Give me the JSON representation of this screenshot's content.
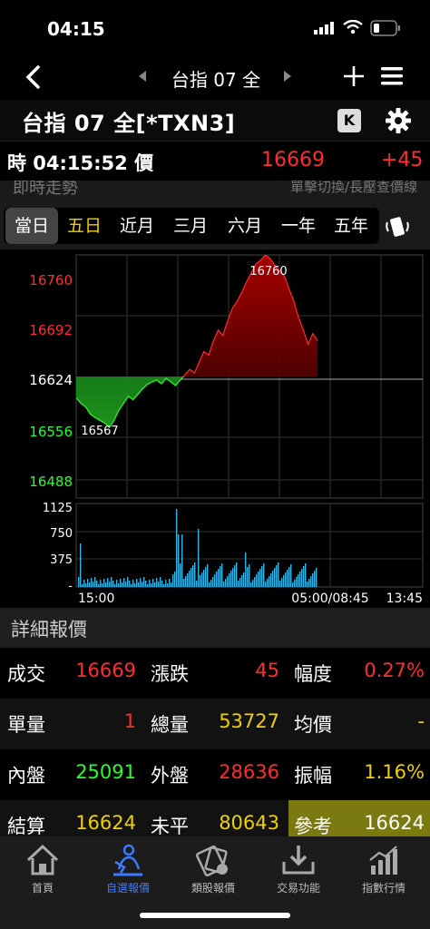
{
  "status": {
    "time": "04:15"
  },
  "nav": {
    "title": "台指 07 全"
  },
  "header": {
    "name": "台指 07 全[*TXN3]",
    "k_label": "K"
  },
  "quote": {
    "time_text": "時 04:15:52 價",
    "price": "16669",
    "change": "+45"
  },
  "subbar": {
    "left": "即時走勢",
    "right": "單擊切換/長壓查價線"
  },
  "periods": {
    "tabs": [
      {
        "label": "當日",
        "active": true
      },
      {
        "label": "五日",
        "highlight": true
      },
      {
        "label": "近月"
      },
      {
        "label": "三月"
      },
      {
        "label": "六月"
      },
      {
        "label": "一年"
      },
      {
        "label": "五年"
      }
    ]
  },
  "chart_data": {
    "type": "area",
    "reference": 16624,
    "ylim": [
      16488,
      16760
    ],
    "price_ticks": [
      "16760",
      "16692",
      "16624",
      "16556",
      "16488"
    ],
    "high_label": "16760",
    "low_label": "16567",
    "volume_ticks": [
      "1125",
      "750",
      "375",
      "-"
    ],
    "x_labels": [
      "15:00",
      "05:00/08:45",
      "13:45"
    ],
    "price_series": [
      16600,
      16594,
      16590,
      16582,
      16578,
      16575,
      16572,
      16567,
      16575,
      16586,
      16594,
      16602,
      16598,
      16604,
      16610,
      16615,
      16618,
      16620,
      16616,
      16622,
      16618,
      16614,
      16620,
      16626,
      16632,
      16628,
      16640,
      16652,
      16648,
      16664,
      16676,
      16670,
      16686,
      16700,
      16708,
      16718,
      16730,
      16740,
      16750,
      16754,
      16760,
      16756,
      16748,
      16742,
      16736,
      16722,
      16708,
      16690,
      16676,
      16660,
      16672,
      16664
    ],
    "up_color": "#ff2d2d",
    "down_color": "#28ff28"
  },
  "details": {
    "title": "詳細報價",
    "rows": [
      [
        {
          "label": "成交",
          "value": "16669",
          "color": "red"
        },
        {
          "label": "漲跌",
          "value": "45",
          "color": "red"
        },
        {
          "label": "幅度",
          "value": "0.27%",
          "color": "red"
        }
      ],
      [
        {
          "label": "單量",
          "value": "1",
          "color": "red"
        },
        {
          "label": "總量",
          "value": "53727",
          "color": "yellow"
        },
        {
          "label": "均價",
          "value": "-",
          "color": "yellow"
        }
      ],
      [
        {
          "label": "內盤",
          "value": "25091",
          "color": "green"
        },
        {
          "label": "外盤",
          "value": "28636",
          "color": "red"
        },
        {
          "label": "振幅",
          "value": "1.16%",
          "color": "yellow"
        }
      ],
      [
        {
          "label": "結算",
          "value": "16624",
          "color": "yellow"
        },
        {
          "label": "未平",
          "value": "80643",
          "color": "yellow"
        },
        {
          "label": "參考",
          "value": "16624",
          "color": "white"
        }
      ]
    ]
  },
  "tabbar": [
    {
      "label": "首頁"
    },
    {
      "label": "自選報價",
      "active": true
    },
    {
      "label": "類股報價"
    },
    {
      "label": "交易功能"
    },
    {
      "label": "指數行情"
    }
  ]
}
